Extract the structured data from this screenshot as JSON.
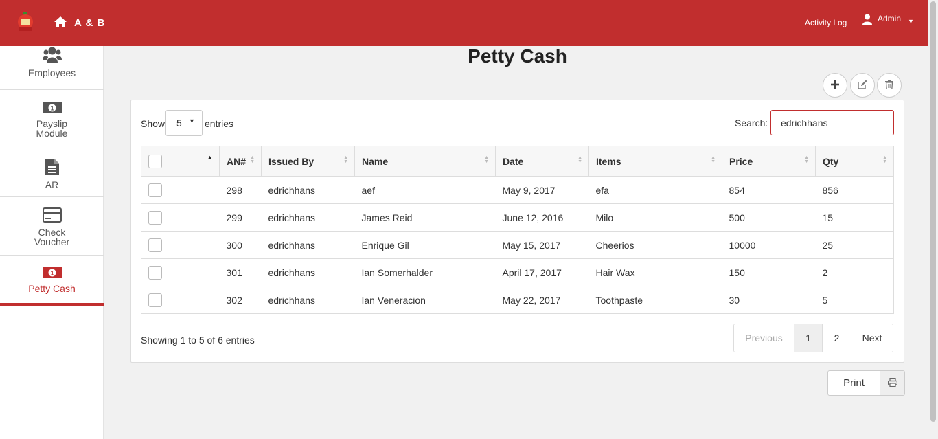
{
  "header": {
    "brand": "A & B",
    "activity_log": "Activity Log",
    "user": "Admin"
  },
  "sidebar": {
    "items": [
      {
        "label": "Employees",
        "icon": "users-icon"
      },
      {
        "label": "Payslip\nModule",
        "icon": "money-icon"
      },
      {
        "label": "AR",
        "icon": "document-icon"
      },
      {
        "label": "Check\nVoucher",
        "icon": "credit-card-icon"
      },
      {
        "label": "Petty Cash",
        "icon": "money-icon",
        "active": true
      }
    ]
  },
  "page": {
    "title": "Petty Cash"
  },
  "table_controls": {
    "show_label": "Show",
    "length_value": "5",
    "entries_label": "entries",
    "search_label": "Search:",
    "search_value": "edrichhans"
  },
  "table": {
    "columns": [
      "AN#",
      "Issued By",
      "Name",
      "Date",
      "Items",
      "Price",
      "Qty"
    ],
    "rows": [
      [
        "298",
        "edrichhans",
        "aef",
        "May 9, 2017",
        "efa",
        "854",
        "856"
      ],
      [
        "299",
        "edrichhans",
        "James Reid",
        "June 12, 2016",
        "Milo",
        "500",
        "15"
      ],
      [
        "300",
        "edrichhans",
        "Enrique Gil",
        "May 15, 2017",
        "Cheerios",
        "10000",
        "25"
      ],
      [
        "301",
        "edrichhans",
        "Ian Somerhalder",
        "April 17, 2017",
        "Hair Wax",
        "150",
        "2"
      ],
      [
        "302",
        "edrichhans",
        "Ian Veneracion",
        "May 22, 2017",
        "Toothpaste",
        "30",
        "5"
      ]
    ]
  },
  "footer": {
    "info": "Showing 1 to 5 of 6 entries",
    "previous": "Previous",
    "page1": "1",
    "page2": "2",
    "next": "Next",
    "print": "Print"
  },
  "colors": {
    "brand": "#c12e2e"
  }
}
